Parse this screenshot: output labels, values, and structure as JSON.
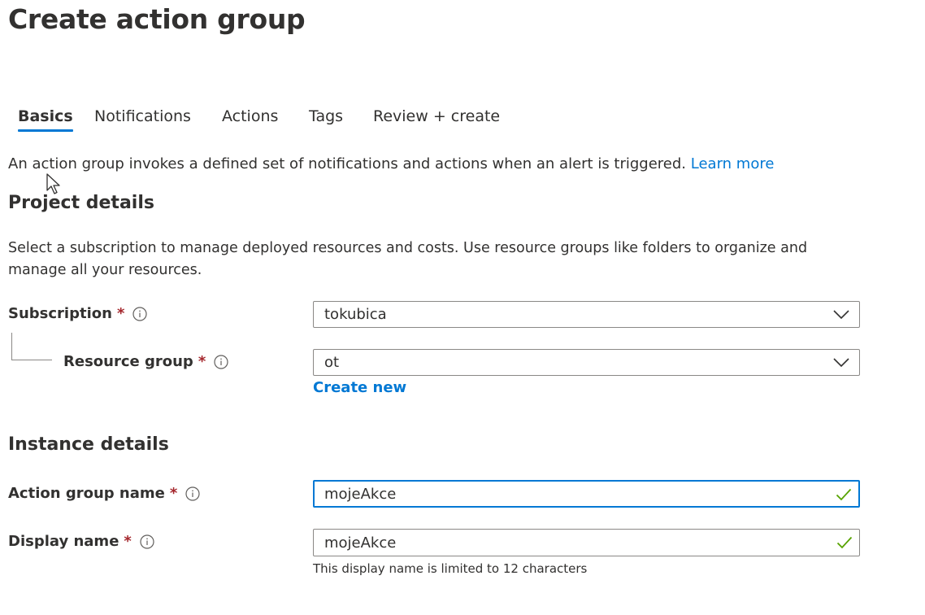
{
  "page": {
    "title": "Create action group"
  },
  "tabs": [
    {
      "label": "Basics",
      "active": true
    },
    {
      "label": "Notifications",
      "active": false
    },
    {
      "label": "Actions",
      "active": false
    },
    {
      "label": "Tags",
      "active": false
    },
    {
      "label": "Review + create",
      "active": false
    }
  ],
  "intro": {
    "text": "An action group invokes a defined set of notifications and actions when an alert is triggered.",
    "link": "Learn more"
  },
  "project": {
    "heading": "Project details",
    "description": "Select a subscription to manage deployed resources and costs. Use resource groups like folders to organize and manage all your resources.",
    "subscription": {
      "label": "Subscription",
      "required": "*",
      "value": "tokubica"
    },
    "resource_group": {
      "label": "Resource group",
      "required": "*",
      "value": "ot"
    },
    "create_new": "Create new"
  },
  "instance": {
    "heading": "Instance details",
    "action_group_name": {
      "label": "Action group name",
      "required": "*",
      "value": "mojeAkce"
    },
    "display_name": {
      "label": "Display name",
      "required": "*",
      "value": "mojeAkce",
      "helper": "This display name is limited to 12 characters"
    }
  },
  "colors": {
    "accent": "#0078d4",
    "required": "#a4262c",
    "valid_check": "#57a300",
    "text": "#323130",
    "border": "#8a8886"
  },
  "icons": {
    "info": "info-icon",
    "dropdown": "chevron-down-icon",
    "valid": "checkmark-icon",
    "pointer": "mouse-cursor-icon"
  }
}
